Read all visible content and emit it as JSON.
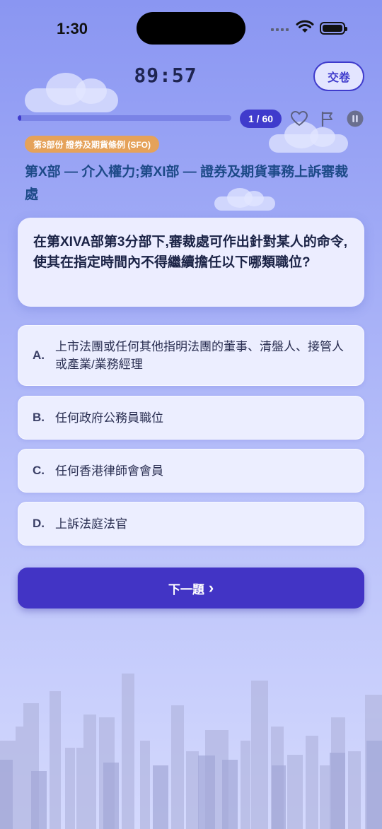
{
  "status_bar": {
    "time": "1:30"
  },
  "header": {
    "timer": "89:57",
    "submit_label": "交卷"
  },
  "progress": {
    "current": 1,
    "total": 60,
    "counter_label": "1 / 60",
    "fraction": 0.0167
  },
  "toolbar": {
    "icons": [
      "heart-icon",
      "flag-icon",
      "pause-icon"
    ]
  },
  "section": {
    "badge": "第3部份 證券及期貨條例 (SFO)",
    "title": "第X部 — 介入權力;第XI部 — 證券及期貨事務上訴審裁處"
  },
  "question": {
    "text": "在第XIVA部第3分部下,審裁處可作出針對某人的命令,使其在指定時間內不得繼續擔任以下哪類職位?"
  },
  "options": [
    {
      "letter": "A.",
      "text": "上市法團或任何其他指明法團的董事、清盤人、接管人或產業/業務經理"
    },
    {
      "letter": "B.",
      "text": "任何政府公務員職位"
    },
    {
      "letter": "C.",
      "text": "任何香港律師會會員"
    },
    {
      "letter": "D.",
      "text": "上訴法庭法官"
    }
  ],
  "next_button": {
    "label": "下一題",
    "arrow": "›"
  },
  "colors": {
    "accent": "#4234c5",
    "badge": "#e5a25a",
    "title": "#1d4a88"
  }
}
